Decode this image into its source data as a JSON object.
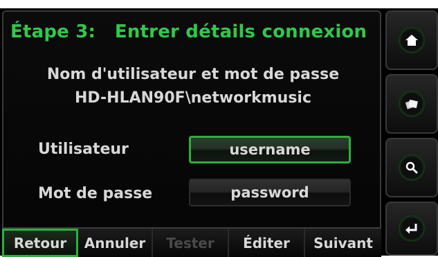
{
  "dialog": {
    "title": "Étape 3:   Entrer détails connexion",
    "subtitle_line1": "Nom d'utilisateur et mot de passe",
    "subtitle_line2": "HD-HLAN90F\\networkmusic"
  },
  "form": {
    "username_label": "Utilisateur",
    "username_value": "username",
    "password_label": "Mot de passe",
    "password_value": "password"
  },
  "bottom_bar": {
    "back": "Retour",
    "cancel": "Annuler",
    "test": "Tester",
    "edit": "Éditer",
    "next": "Suivant"
  },
  "side_buttons": [
    {
      "icon": "home-icon"
    },
    {
      "icon": "media-library-icon"
    },
    {
      "icon": "search-icon"
    },
    {
      "icon": "enter-return-icon"
    }
  ],
  "colors": {
    "accent_green": "#2fc94b",
    "text": "#d8d8d8",
    "disabled_text": "#4a4a4a",
    "background": "#000000"
  }
}
